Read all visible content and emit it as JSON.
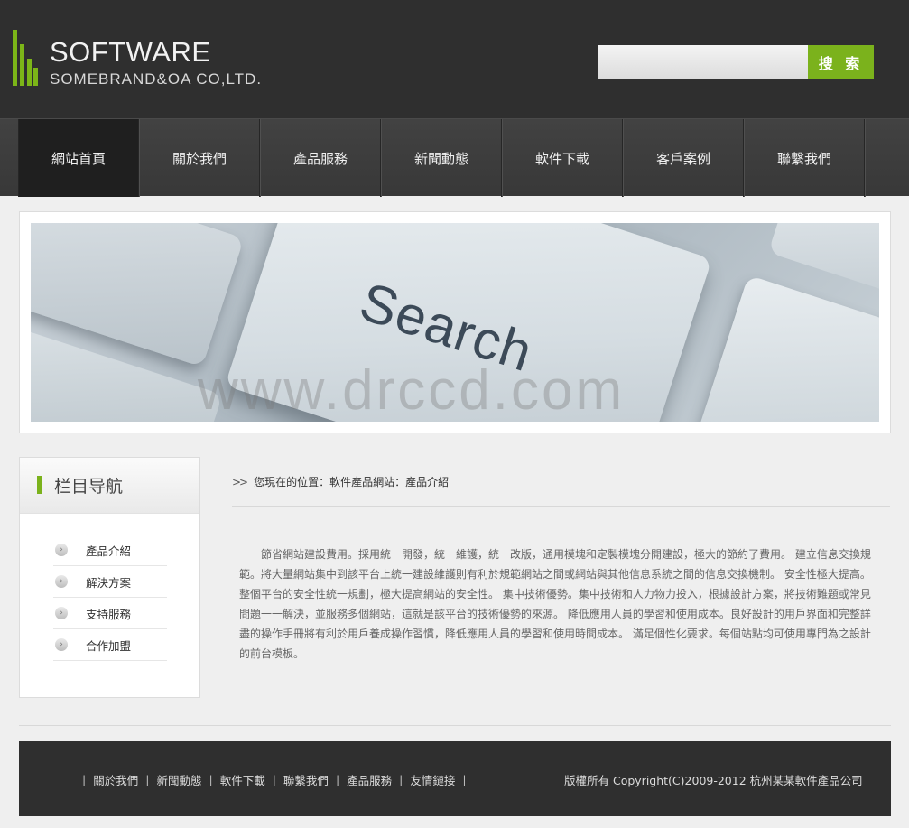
{
  "header": {
    "logo_title": "SOFTWARE",
    "logo_subtitle": "SOMEBRAND&OA CO,LTD.",
    "search_placeholder": "",
    "search_button": "搜 索"
  },
  "nav": {
    "items": [
      "網站首頁",
      "關於我們",
      "產品服務",
      "新聞動態",
      "軟件下載",
      "客戶案例",
      "聯繫我們"
    ],
    "active_index": 0
  },
  "banner": {
    "key_text": "Search",
    "watermark": "www.drccd.com"
  },
  "sidebar": {
    "title": "栏目导航",
    "items": [
      "產品介紹",
      "解決方案",
      "支持服務",
      "合作加盟"
    ]
  },
  "content": {
    "breadcrumb": "您現在的位置：軟件產品網站：產品介紹",
    "article": "節省網站建設費用。採用統一開發，統一維護，統一改版，通用模塊和定製模塊分開建設，極大的節約了費用。 建立信息交換規範。將大量網站集中到該平台上統一建設維護則有利於規範網站之間或網站與其他信息系統之間的信息交換機制。 安全性極大提高。整個平台的安全性統一規劃，極大提高網站的安全性。 集中技術優勢。集中技術和人力物力投入，根據設計方案，將技術難題或常見問題一一解決，並服務多個網站，這就是該平台的技術優勢的來源。 降低應用人員的學習和使用成本。良好設計的用戶界面和完整詳盡的操作手冊將有利於用戶養成操作習慣，降低應用人員的學習和使用時間成本。 滿足個性化要求。每個站點均可使用專門為之設計的前台模板。"
  },
  "footer": {
    "links": [
      "關於我們",
      "新聞動態",
      "軟件下載",
      "聯繫我們",
      "產品服務",
      "友情鏈接"
    ],
    "copyright": "版權所有 Copyright(C)2009-2012 杭州某某軟件產品公司"
  },
  "colors": {
    "accent": "#7bb21c",
    "header_bg": "#2f2f2f",
    "nav_bg": "#3d3d3d",
    "page_bg": "#efefef"
  }
}
